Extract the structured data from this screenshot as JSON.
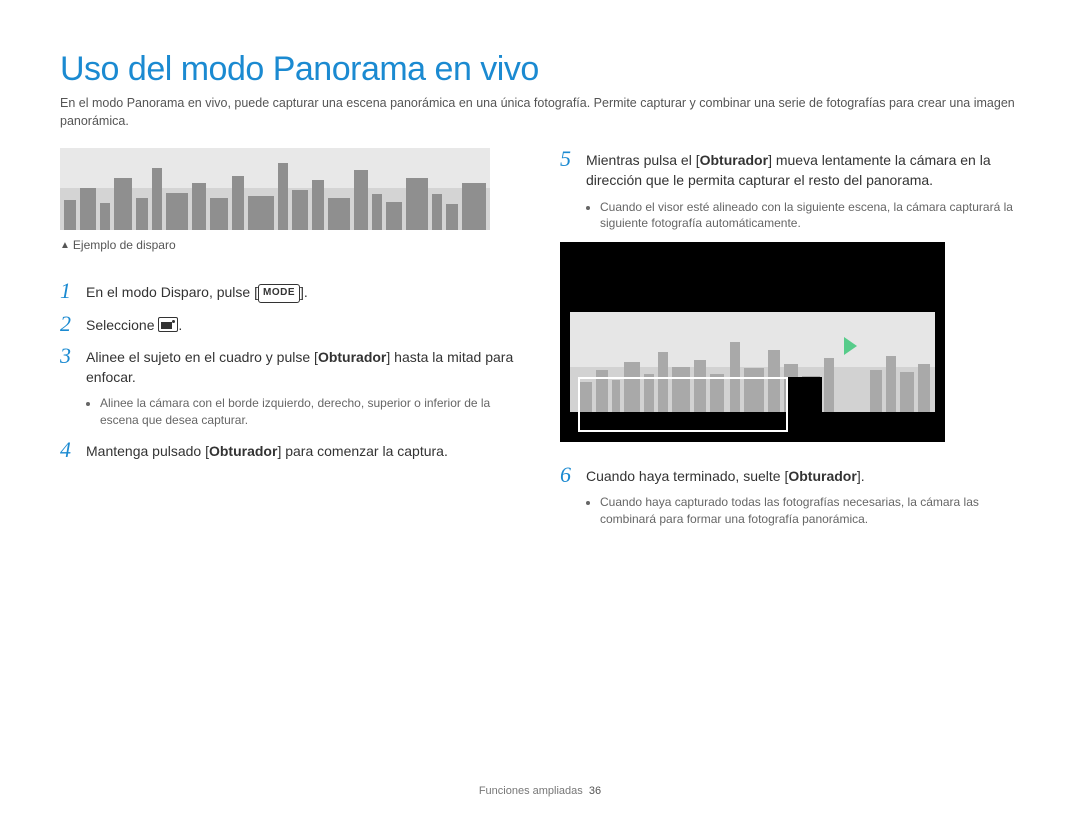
{
  "title": "Uso del modo Panorama en vivo",
  "intro": "En el modo Panorama en vivo, puede capturar una escena panorámica en una única fotografía. Permite capturar y combinar una serie de fotografías para crear una imagen panorámica.",
  "example_caption": "Ejemplo de disparo",
  "mode_button_label": "MODE",
  "left_steps": {
    "s1": {
      "num": "1",
      "text_pre": "En el modo Disparo, pulse [",
      "text_post": "]."
    },
    "s2": {
      "num": "2",
      "text_pre": "Seleccione ",
      "text_post": "."
    },
    "s3": {
      "num": "3",
      "text_a": "Alinee el sujeto en el cuadro y pulse [",
      "bold": "Obturador",
      "text_b": "] hasta la mitad para enfocar.",
      "bullet": "Alinee la cámara con el borde izquierdo, derecho, superior o inferior de la escena que desea capturar."
    },
    "s4": {
      "num": "4",
      "text_a": "Mantenga pulsado [",
      "bold": "Obturador",
      "text_b": "] para comenzar la captura."
    }
  },
  "right_steps": {
    "s5": {
      "num": "5",
      "text_a": "Mientras pulsa el [",
      "bold": "Obturador",
      "text_b": "] mueva lentamente la cámara en la dirección que le permita capturar el resto del panorama.",
      "bullet": "Cuando el visor esté alineado con la siguiente escena, la cámara capturará la siguiente fotografía automáticamente."
    },
    "s6": {
      "num": "6",
      "text_a": "Cuando haya terminado, suelte [",
      "bold": "Obturador",
      "text_b": "].",
      "bullet": "Cuando haya capturado todas las fotografías necesarias, la cámara las combinará para formar una fotografía panorámica."
    }
  },
  "footer_section": "Funciones ampliadas",
  "footer_page": "36"
}
